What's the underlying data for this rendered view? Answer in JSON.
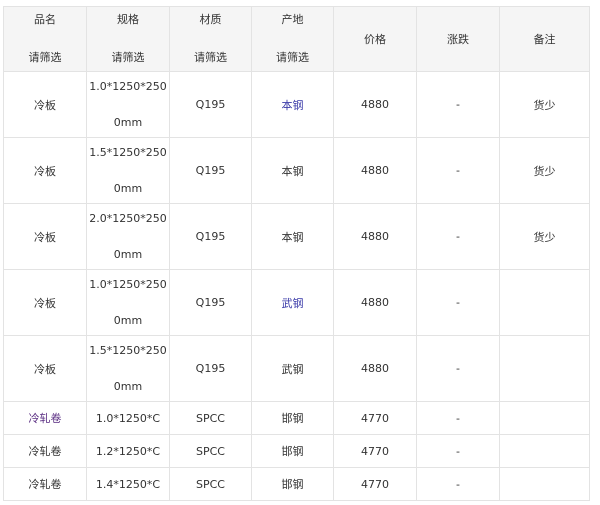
{
  "header": {
    "name": {
      "label": "品名",
      "filter": "请筛选"
    },
    "spec": {
      "label": "规格",
      "filter": "请筛选"
    },
    "material": {
      "label": "材质",
      "filter": "请筛选"
    },
    "origin": {
      "label": "产地",
      "filter": "请筛选"
    },
    "price": "价格",
    "change": "涨跌",
    "note": "备注"
  },
  "rows": [
    {
      "name": "冷板",
      "spec1": "1.0*1250*250",
      "spec2": "0mm",
      "material": "Q195",
      "origin": "本钢",
      "price": "4880",
      "change": "-",
      "note": "货少"
    },
    {
      "name": "冷板",
      "spec1": "1.5*1250*250",
      "spec2": "0mm",
      "material": "Q195",
      "origin": "本钢",
      "price": "4880",
      "change": "-",
      "note": "货少"
    },
    {
      "name": "冷板",
      "spec1": "2.0*1250*250",
      "spec2": "0mm",
      "material": "Q195",
      "origin": "本钢",
      "price": "4880",
      "change": "-",
      "note": "货少"
    },
    {
      "name": "冷板",
      "spec1": "1.0*1250*250",
      "spec2": "0mm",
      "material": "Q195",
      "origin": "武钢",
      "price": "4880",
      "change": "-",
      "note": ""
    },
    {
      "name": "冷板",
      "spec1": "1.5*1250*250",
      "spec2": "0mm",
      "material": "Q195",
      "origin": "武钢",
      "price": "4880",
      "change": "-",
      "note": ""
    },
    {
      "name": "冷轧卷",
      "spec": "1.0*1250*C",
      "material": "SPCC",
      "origin": "邯钢",
      "price": "4770",
      "change": "-",
      "note": ""
    },
    {
      "name": "冷轧卷",
      "spec": "1.2*1250*C",
      "material": "SPCC",
      "origin": "邯钢",
      "price": "4770",
      "change": "-",
      "note": ""
    },
    {
      "name": "冷轧卷",
      "spec": "1.4*1250*C",
      "material": "SPCC",
      "origin": "邯钢",
      "price": "4770",
      "change": "-",
      "note": ""
    }
  ],
  "colors": {
    "link": "#3a3aa8",
    "visited_link": "#5a2d82",
    "header_bg": "#f5f5f5",
    "border": "#e3e3e3"
  }
}
